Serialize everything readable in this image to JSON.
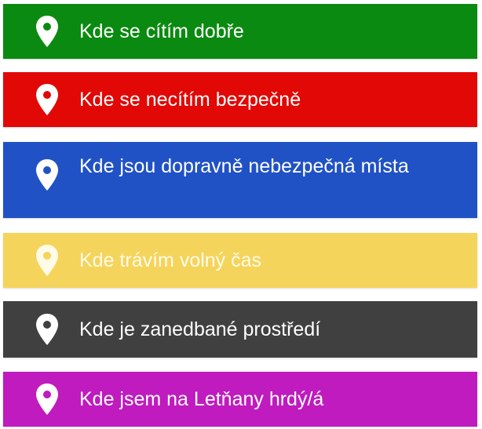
{
  "buttons": [
    {
      "label": "Kde se cítím dobře",
      "color": "#0b8a11",
      "icon": "map-pin-icon"
    },
    {
      "label": "Kde se necítím bezpečně",
      "color": "#e10806",
      "icon": "map-pin-icon"
    },
    {
      "label": "Kde jsou dopravně nebezpečná místa",
      "color": "#2052c6",
      "icon": "map-pin-icon"
    },
    {
      "label": "Kde trávím volný čas",
      "color": "#f5d45c",
      "icon": "map-pin-icon"
    },
    {
      "label": "Kde je zanedbané prostředí",
      "color": "#404040",
      "icon": "map-pin-icon"
    },
    {
      "label": "Kde jsem na Letňany hrdý/á",
      "color": "#bf1bbf",
      "icon": "map-pin-icon"
    }
  ]
}
